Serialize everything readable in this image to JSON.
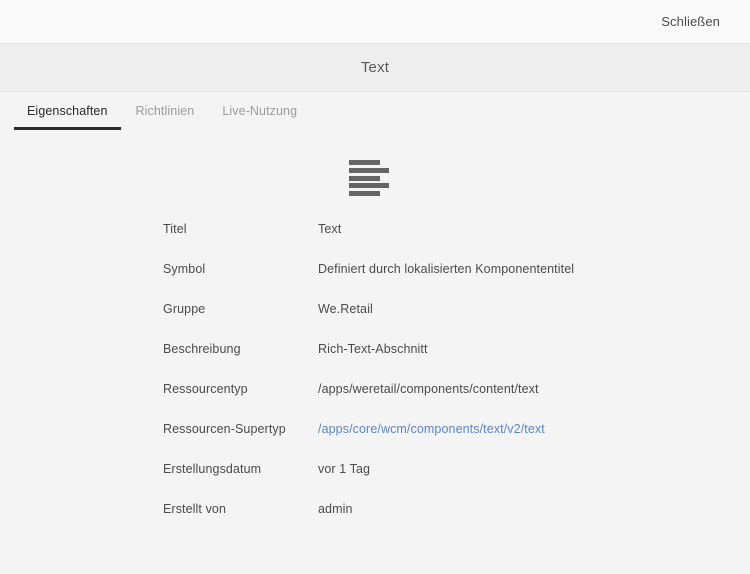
{
  "topbar": {
    "close_label": "Schließen"
  },
  "title": "Text",
  "tabs": [
    {
      "label": "Eigenschaften",
      "active": true
    },
    {
      "label": "Richtlinien",
      "active": false
    },
    {
      "label": "Live-Nutzung",
      "active": false
    }
  ],
  "component_icon": {
    "name": "text-paragraph-icon",
    "bars": [
      "short",
      "long",
      "short",
      "long",
      "short"
    ],
    "color": "#656565"
  },
  "properties": [
    {
      "label": "Titel",
      "value": "Text",
      "link": false
    },
    {
      "label": "Symbol",
      "value": "Definiert durch lokalisierten Komponententitel",
      "link": false
    },
    {
      "label": "Gruppe",
      "value": "We.Retail",
      "link": false
    },
    {
      "label": "Beschreibung",
      "value": "Rich-Text-Abschnitt",
      "link": false
    },
    {
      "label": "Ressourcentyp",
      "value": "/apps/weretail/components/content/text",
      "link": false
    },
    {
      "label": "Ressourcen-Supertyp",
      "value": "/apps/core/wcm/components/text/v2/text",
      "link": true
    },
    {
      "label": "Erstellungsdatum",
      "value": "vor 1 Tag",
      "link": false
    },
    {
      "label": "Erstellt von",
      "value": "admin",
      "link": false
    }
  ],
  "colors": {
    "topbar_bg": "#fafafa",
    "titlebar_bg": "#eeeeee",
    "content_bg": "#f4f4f4",
    "text": "#4b4b4b",
    "muted_text": "#9b9b9b",
    "active_tab": "#2b2b2b",
    "link": "#5b86c7"
  }
}
